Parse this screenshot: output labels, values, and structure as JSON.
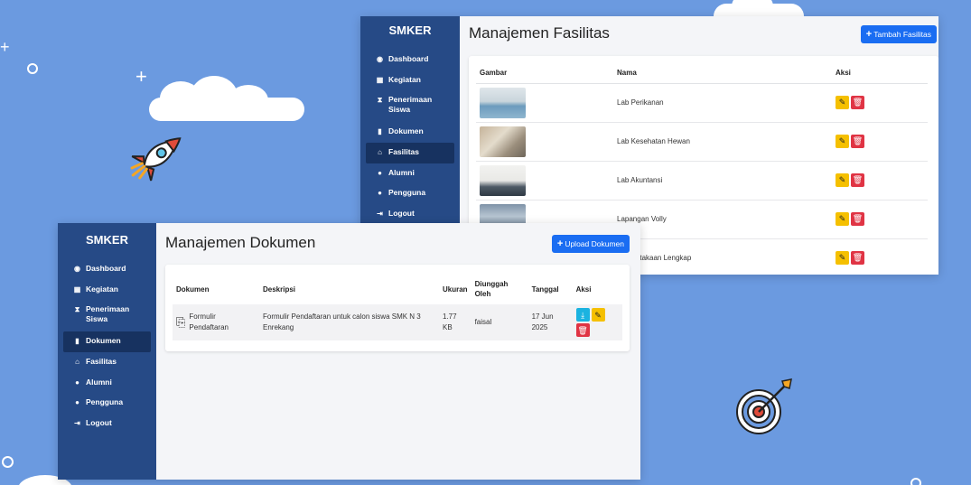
{
  "colors": {
    "background": "#6b9ae0",
    "sidebar": "#264a86",
    "sidebar_active": "#173260",
    "primary": "#1a6df2",
    "edit": "#f5c000",
    "delete": "#e03444",
    "download": "#1bb3e0"
  },
  "facilities_window": {
    "brand": "SMKER",
    "nav": [
      {
        "label": "Dashboard",
        "icon": "gauge-icon"
      },
      {
        "label": "Kegiatan",
        "icon": "calendar-icon"
      },
      {
        "label": "Penerimaan Siswa",
        "icon": "hourglass-icon"
      },
      {
        "label": "Dokumen",
        "icon": "file-icon"
      },
      {
        "label": "Fasilitas",
        "icon": "building-icon",
        "active": true
      },
      {
        "label": "Alumni",
        "icon": "users-icon"
      },
      {
        "label": "Pengguna",
        "icon": "user-group-icon"
      },
      {
        "label": "Logout",
        "icon": "logout-icon"
      }
    ],
    "title": "Manajemen Fasilitas",
    "add_button": "Tambah Fasilitas",
    "table": {
      "headers": [
        "Gambar",
        "Nama",
        "Aksi"
      ],
      "rows": [
        {
          "name": "Lab Perikanan"
        },
        {
          "name": "Lab Kesehatan Hewan"
        },
        {
          "name": "Lab Akuntansi"
        },
        {
          "name": "Lapangan Volly"
        },
        {
          "name": "Perpustakaan Lengkap"
        }
      ]
    }
  },
  "documents_window": {
    "brand": "SMKER",
    "nav": [
      {
        "label": "Dashboard",
        "icon": "gauge-icon"
      },
      {
        "label": "Kegiatan",
        "icon": "calendar-icon"
      },
      {
        "label": "Penerimaan Siswa",
        "icon": "hourglass-icon"
      },
      {
        "label": "Dokumen",
        "icon": "file-icon",
        "active": true
      },
      {
        "label": "Fasilitas",
        "icon": "building-icon"
      },
      {
        "label": "Alumni",
        "icon": "users-icon"
      },
      {
        "label": "Pengguna",
        "icon": "user-group-icon"
      },
      {
        "label": "Logout",
        "icon": "logout-icon"
      }
    ],
    "title": "Manajemen Dokumen",
    "upload_button": "Upload Dokumen",
    "table": {
      "headers": [
        "Dokumen",
        "Deskripsi",
        "Ukuran",
        "Diunggah Oleh",
        "Tanggal",
        "Aksi"
      ],
      "rows": [
        {
          "document": "Formulir Pendaftaran",
          "description": "Formulir Pendaftaran untuk calon siswa SMK N 3 Enrekang",
          "size": "1.77 KB",
          "uploaded_by": "faisal",
          "date": "17 Jun 2025"
        }
      ]
    }
  }
}
